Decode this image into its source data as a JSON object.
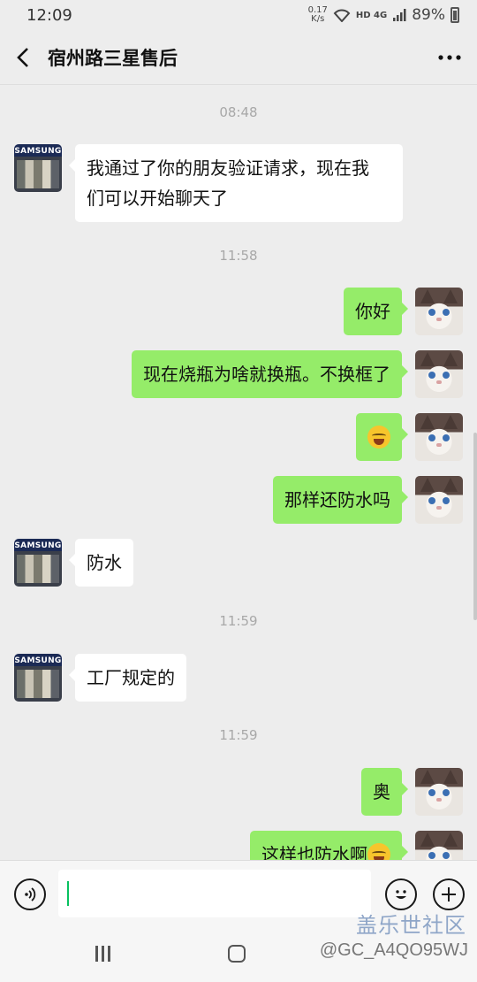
{
  "status_bar": {
    "time": "12:09",
    "net_speed_value": "0.17",
    "net_speed_unit": "K/s",
    "network": "HD 4G",
    "battery": "89%"
  },
  "header": {
    "title": "宿州路三星售后",
    "back_icon": "chevron-left-icon",
    "more_icon": "more-dots-icon"
  },
  "timestamps": [
    "08:48",
    "11:58",
    "11:59",
    "11:59"
  ],
  "contact_avatar_label": "SAMSUNG",
  "messages": [
    {
      "side": "in",
      "text": "我通过了你的朋友验证请求，现在我",
      "text2": "们可以开始聊天了"
    },
    {
      "side": "out",
      "text": "你好"
    },
    {
      "side": "out",
      "text": "现在烧瓶为啥就换瓶。不换框了"
    },
    {
      "side": "out",
      "text": "",
      "emoji": "crying-laughing-face"
    },
    {
      "side": "out",
      "text": "那样还防水吗"
    },
    {
      "side": "in",
      "text": "防水"
    },
    {
      "side": "in",
      "text": "工厂规定的"
    },
    {
      "side": "out",
      "text": "奥"
    },
    {
      "side": "out",
      "text": "这样也防水啊",
      "emoji": "crying-laughing-face"
    }
  ],
  "input_bar": {
    "value": "",
    "voice_icon": "voice-icon",
    "emoji_icon": "smiley-icon",
    "plus_icon": "plus-icon"
  },
  "watermark": {
    "site": "盖乐世社区",
    "user": "@GC_A4QO95WJ"
  },
  "colors": {
    "outgoing_bubble": "#95ec69",
    "incoming_bubble": "#ffffff",
    "background": "#ededed",
    "caret": "#07c160"
  }
}
